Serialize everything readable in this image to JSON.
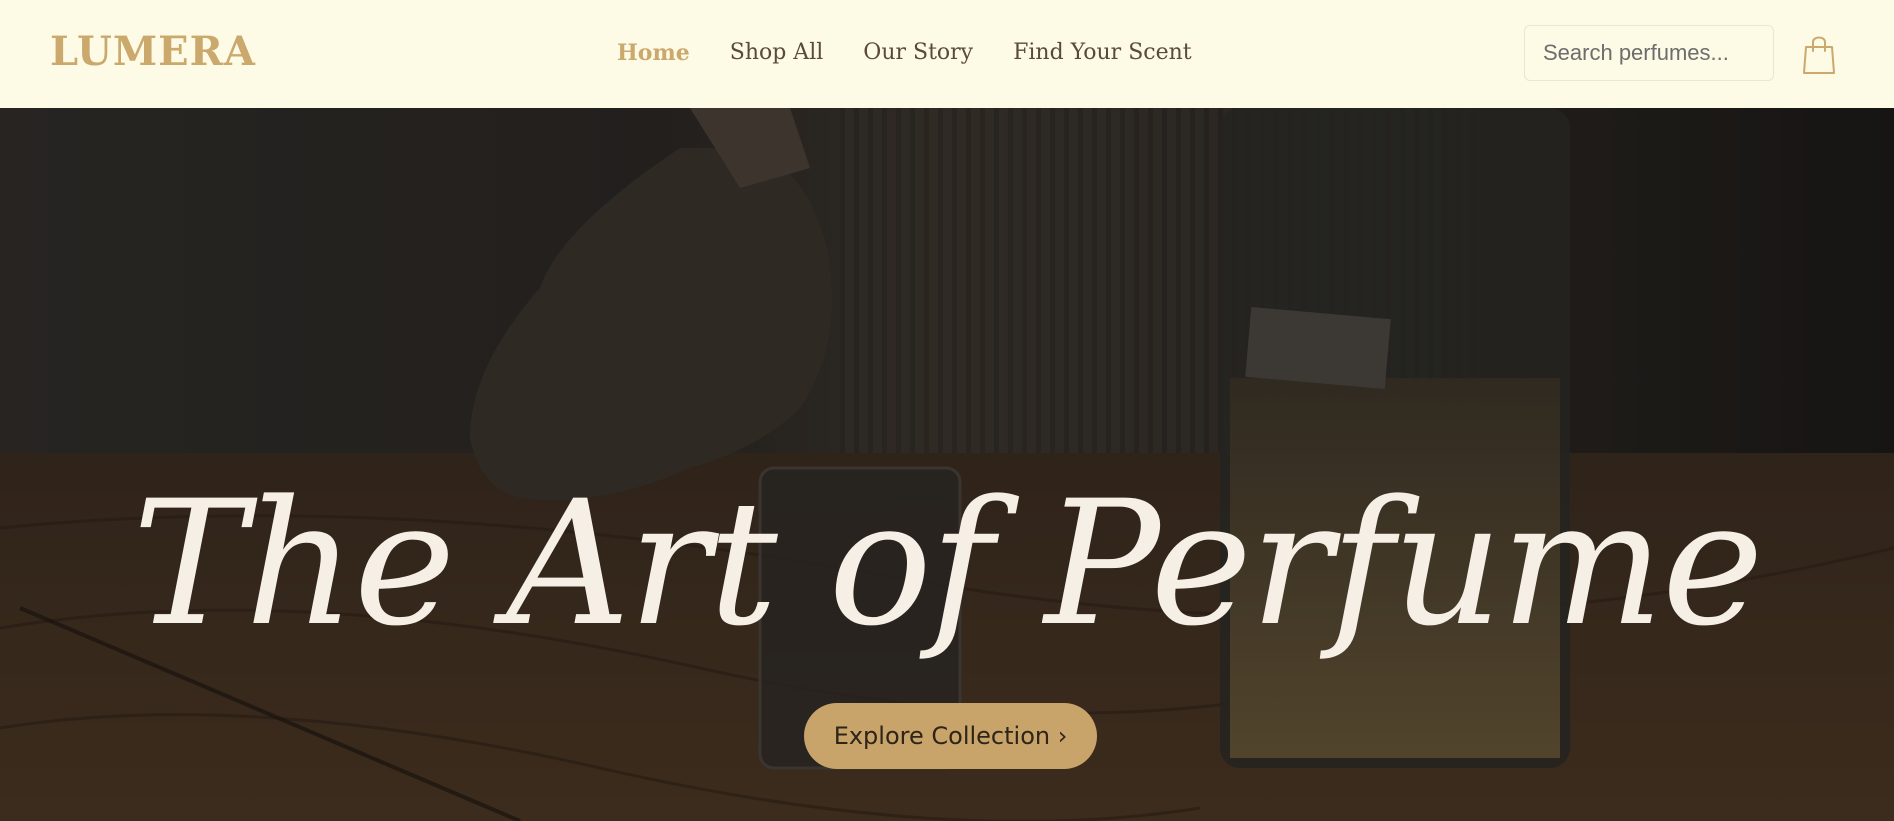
{
  "brand": {
    "logo_text": "LUMERA"
  },
  "nav": {
    "items": [
      {
        "label": "Home",
        "active": true
      },
      {
        "label": "Shop All",
        "active": false
      },
      {
        "label": "Our Story",
        "active": false
      },
      {
        "label": "Find Your Scent",
        "active": false
      }
    ]
  },
  "search": {
    "placeholder": "Search perfumes...",
    "value": ""
  },
  "cart": {
    "icon": "shopping-bag-icon"
  },
  "hero": {
    "title": "The Art of Perfume",
    "cta_label": "Explore Collection ›",
    "background_description_icon": "perfume-lab-photo"
  },
  "colors": {
    "header_bg": "#fdfae6",
    "accent_gold": "#cba96c",
    "nav_text": "#5a4a3a",
    "hero_title": "#f5efe6",
    "cta_bg": "#c8a46a",
    "cta_text": "#2e2418"
  }
}
